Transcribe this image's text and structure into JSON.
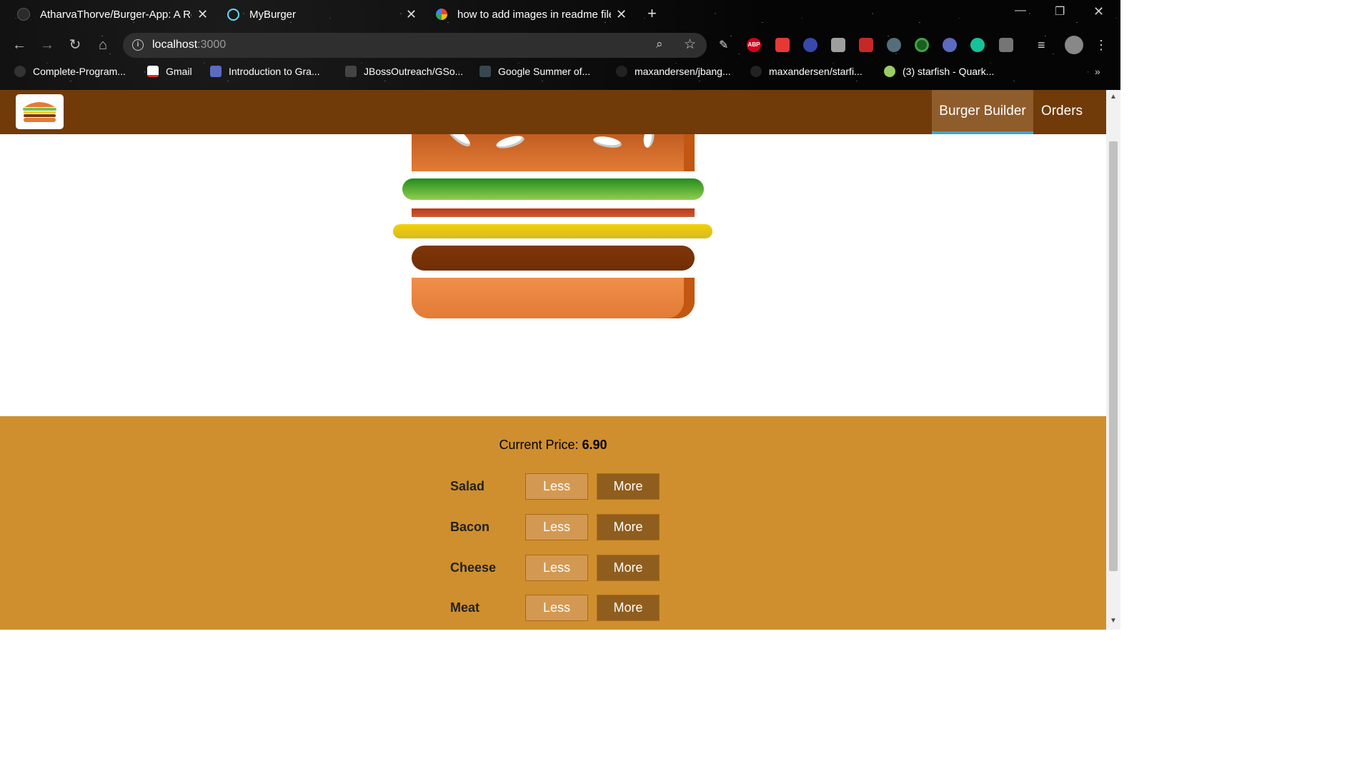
{
  "browser": {
    "tabs": [
      {
        "title": "AtharvaThorve/Burger-App: A Re",
        "icon": "github-icon"
      },
      {
        "title": "MyBurger",
        "icon": "react-icon"
      },
      {
        "title": "how to add images in readme file",
        "icon": "google-icon"
      }
    ],
    "close_glyph": "✕",
    "new_tab_glyph": "+",
    "address": {
      "host": "localhost",
      "port": ":3000"
    },
    "bookmarks": [
      "Complete-Program...",
      "Gmail",
      "Introduction to Gra...",
      "JBossOutreach/GSo...",
      "Google Summer of...",
      "maxandersen/jbang...",
      "maxandersen/starfi...",
      "(3) starfish - Quark..."
    ],
    "bookmarks_more": "»",
    "extensions": [
      "pen-icon",
      "adblock-icon",
      "arrow-ext-icon",
      "glasses-icon",
      "font-ext-icon",
      "puzzle-ext-icon",
      "satellite-icon",
      "target-icon",
      "circle-icon",
      "grammarly-icon",
      "list-ext-icon",
      "playlist-icon",
      "profile-avatar"
    ]
  },
  "toolbar": {
    "logo_alt": "burger-logo",
    "nav": [
      {
        "label": "Burger Builder",
        "active": true
      },
      {
        "label": "Orders",
        "active": false
      }
    ]
  },
  "burger": {
    "ingredients": [
      "bread-top",
      "salad",
      "bacon",
      "cheese",
      "meat",
      "bread-bottom"
    ]
  },
  "controls": {
    "price_label": "Current Price:",
    "price_value": "6.90",
    "rows": [
      {
        "label": "Salad",
        "less": "Less",
        "more": "More"
      },
      {
        "label": "Bacon",
        "less": "Less",
        "more": "More"
      },
      {
        "label": "Cheese",
        "less": "Less",
        "more": "More"
      },
      {
        "label": "Meat",
        "less": "Less",
        "more": "More"
      }
    ]
  },
  "colors": {
    "toolbar_bg": "#703b09",
    "active_nav_bg": "#8f5c2c",
    "active_underline": "#40a4c8",
    "controls_bg": "#cf8f2e",
    "less_bg": "#d39952",
    "more_bg": "#8f5e1e"
  }
}
